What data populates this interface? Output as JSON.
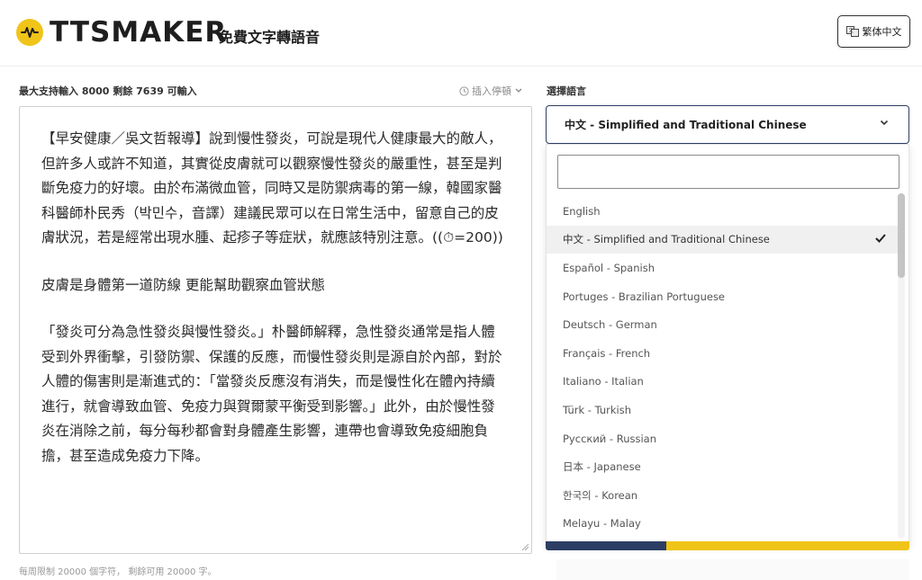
{
  "header": {
    "logo_text": "TTSMAKER",
    "tagline": "免費文字轉語音",
    "lang_switch_label": "繁体中文"
  },
  "editor": {
    "limit_prefix": "最大支持輸入",
    "max_chars": "8000",
    "limit_middle": "剩餘",
    "remaining_chars": "7639",
    "limit_suffix": "可輸入",
    "pause_label": "插入停頓",
    "paragraphs": [
      "【早安健康／吳文哲報導】說到慢性發炎，可說是現代人健康最大的敵人，但許多人或許不知道，其實從皮膚就可以觀察慢性發炎的嚴重性，甚至是判斷免疫力的好壞。由於布滿微血管，同時又是防禦病毒的第一線，韓國家醫科醫師朴民秀（박민수，音譯）建議民眾可以在日常生活中，留意自己的皮膚狀況，若是經常出現水腫、起疹子等症狀，就應該特別注意。((⏱=200))",
      "皮膚是身體第一道防線 更能幫助觀察血管狀態",
      "「發炎可分為急性發炎與慢性發炎。」朴醫師解釋，急性發炎通常是指人體受到外界衝擊，引發防禦、保護的反應，而慢性發炎則是源自於內部，對於人體的傷害則是漸進式的：「當發炎反應沒有消失，而是慢性化在體內持續進行，就會導致血管、免疫力與賀爾蒙平衡受到影響。」此外，由於慢性發炎在消除之前，每分每秒都會對身體產生影響，連帶也會導致免疫細胞負擔，甚至造成免疫力下降。"
    ],
    "quota_text": "每周限制 20000 個字符， 剩餘可用 20000 字。"
  },
  "language": {
    "label": "選擇語言",
    "selected": "中文 - Simplified and Traditional Chinese",
    "search_value": "",
    "options": [
      "English",
      "中文 - Simplified and Traditional Chinese",
      "Español - Spanish",
      "Portuges - Brazilian Portuguese",
      "Deutsch - German",
      "Français - French",
      "Italiano - Italian",
      "Türk - Turkish",
      "Русский - Russian",
      "日本 - Japanese",
      "한국의 - Korean",
      "Melayu - Malay"
    ],
    "selected_index": 1
  },
  "colors": {
    "brand_yellow": "#f0c419",
    "brand_navy": "#2c3e64"
  }
}
